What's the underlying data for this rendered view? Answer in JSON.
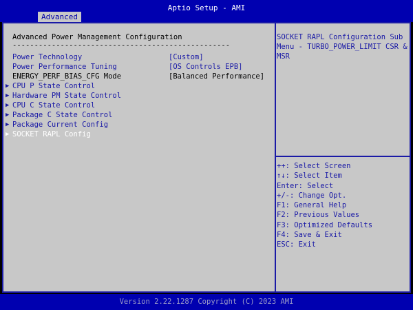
{
  "header": {
    "title": "Aptio Setup - AMI",
    "tab": "Advanced"
  },
  "main": {
    "heading": "Advanced Power Management Configuration",
    "separator": "--------------------------------------------------",
    "items": [
      {
        "label": "Power Technology",
        "value": "[Custom]"
      },
      {
        "label": "Power Performance Tuning",
        "value": "[OS Controls EPB]"
      },
      {
        "label": "ENERGY_PERF_BIAS_CFG Mode",
        "value": "[Balanced Performance]"
      },
      {
        "label": "CPU P State Control",
        "arrow": "▶"
      },
      {
        "label": "Hardware PM State Control",
        "arrow": "▶"
      },
      {
        "label": "CPU C State Control",
        "arrow": "▶"
      },
      {
        "label": "Package C State Control",
        "arrow": "▶"
      },
      {
        "label": "Package Current Config",
        "arrow": "▶"
      },
      {
        "label": "SOCKET RAPL Config",
        "arrow": "▶"
      }
    ]
  },
  "help": {
    "text": "SOCKET RAPL Configuration Sub Menu - TURBO_POWER_LIMIT CSR & MSR"
  },
  "keys": [
    "++: Select Screen",
    "↑↓: Select Item",
    "Enter: Select",
    "+/-: Change Opt.",
    "F1: General Help",
    "F2: Previous Values",
    "F3: Optimized Defaults",
    "F4: Save & Exit",
    "ESC: Exit"
  ],
  "footer": {
    "text": "Version 2.22.1287 Copyright (C) 2023 AMI"
  },
  "colors": {
    "bar": "#0000b0",
    "panel": "#c8c8c8",
    "item_text": "#1a1aa6",
    "selected_text": "#ffffff"
  }
}
